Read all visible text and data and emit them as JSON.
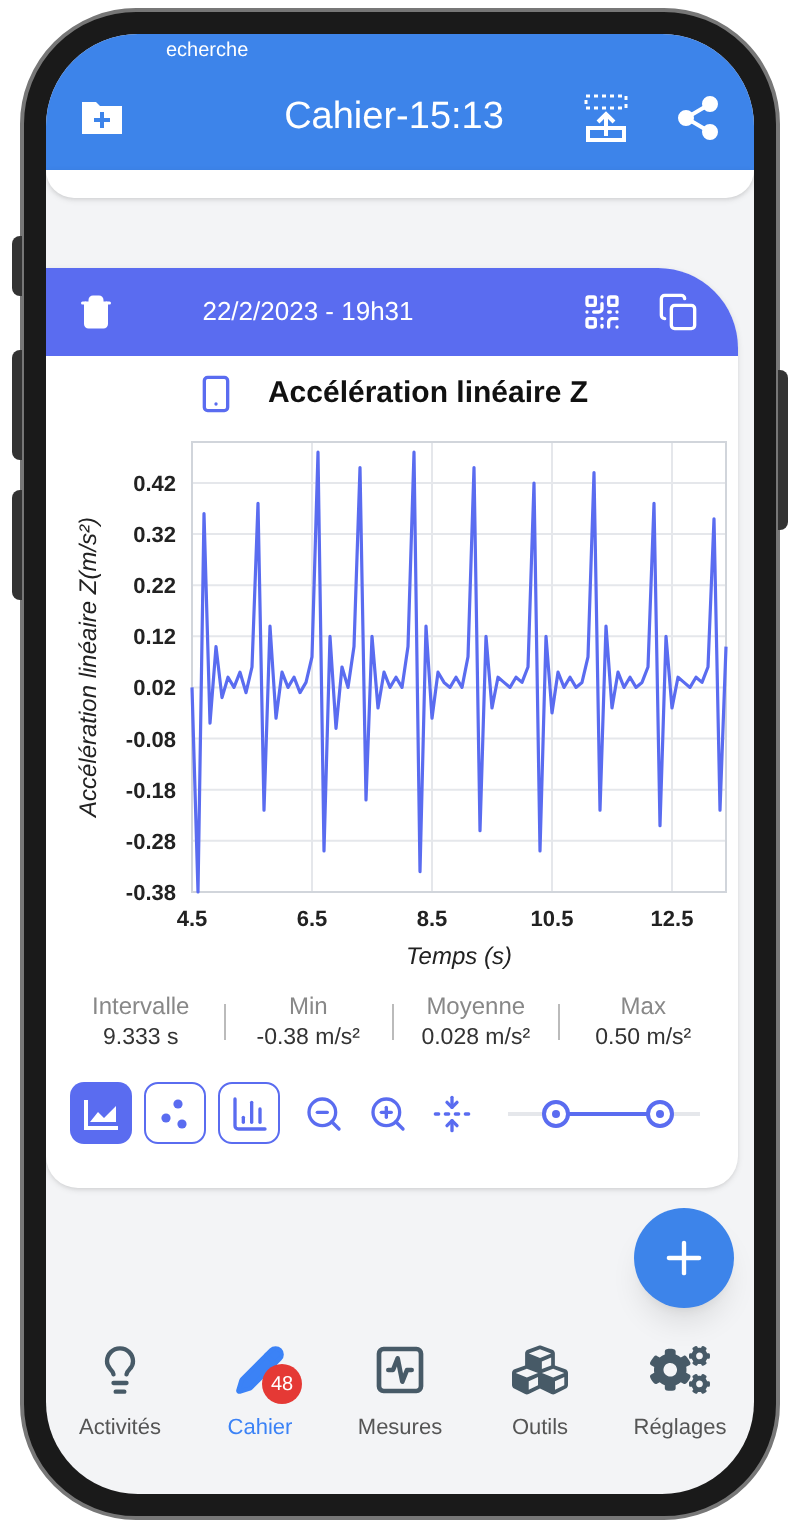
{
  "status_bar": {
    "text": "echerche"
  },
  "header": {
    "title": "Cahier-15:13"
  },
  "entry": {
    "date": "22/2/2023 - 19h31",
    "title": "Accélération linéaire Z",
    "chart_data": {
      "type": "line",
      "xlabel": "Temps (s)",
      "ylabel": "Accélération linéaire Z(m/s²)",
      "x": [
        4.5,
        4.6,
        4.7,
        4.8,
        4.9,
        5.0,
        5.1,
        5.2,
        5.3,
        5.4,
        5.5,
        5.6,
        5.7,
        5.8,
        5.9,
        6.0,
        6.1,
        6.2,
        6.3,
        6.4,
        6.5,
        6.6,
        6.7,
        6.8,
        6.9,
        7.0,
        7.1,
        7.2,
        7.3,
        7.4,
        7.5,
        7.6,
        7.7,
        7.8,
        7.9,
        8.0,
        8.1,
        8.2,
        8.3,
        8.4,
        8.5,
        8.6,
        8.7,
        8.8,
        8.9,
        9.0,
        9.1,
        9.2,
        9.3,
        9.4,
        9.5,
        9.6,
        9.7,
        9.8,
        9.9,
        10.0,
        10.1,
        10.2,
        10.3,
        10.4,
        10.5,
        10.6,
        10.7,
        10.8,
        10.9,
        11.0,
        11.1,
        11.2,
        11.3,
        11.4,
        11.5,
        11.6,
        11.7,
        11.8,
        11.9,
        12.0,
        12.1,
        12.2,
        12.3,
        12.4,
        12.5,
        12.6,
        12.7,
        12.8,
        12.9,
        13.0,
        13.1,
        13.2,
        13.3,
        13.4
      ],
      "grid": true,
      "series": [
        {
          "color": "#5a6cf0",
          "values": [
            0.02,
            -0.38,
            0.36,
            -0.05,
            0.1,
            0.0,
            0.04,
            0.02,
            0.05,
            0.01,
            0.06,
            0.38,
            -0.22,
            0.14,
            -0.04,
            0.05,
            0.02,
            0.04,
            0.01,
            0.03,
            0.08,
            0.48,
            -0.3,
            0.12,
            -0.06,
            0.06,
            0.02,
            0.1,
            0.45,
            -0.2,
            0.12,
            -0.02,
            0.05,
            0.02,
            0.04,
            0.02,
            0.1,
            0.48,
            -0.34,
            0.14,
            -0.04,
            0.05,
            0.03,
            0.02,
            0.04,
            0.02,
            0.08,
            0.45,
            -0.26,
            0.12,
            -0.02,
            0.04,
            0.03,
            0.02,
            0.04,
            0.03,
            0.06,
            0.42,
            -0.3,
            0.12,
            -0.03,
            0.05,
            0.02,
            0.04,
            0.02,
            0.03,
            0.08,
            0.44,
            -0.22,
            0.14,
            -0.02,
            0.05,
            0.02,
            0.04,
            0.02,
            0.03,
            0.06,
            0.38,
            -0.25,
            0.12,
            -0.02,
            0.04,
            0.03,
            0.02,
            0.04,
            0.03,
            0.06,
            0.35,
            -0.22,
            0.1
          ]
        }
      ],
      "xlim": [
        4.5,
        13.4
      ],
      "ylim": [
        -0.38,
        0.5
      ],
      "xticks": [
        4.5,
        6.5,
        8.5,
        10.5,
        12.5
      ],
      "yticks": [
        0.42,
        0.32,
        0.22,
        0.12,
        0.02,
        -0.08,
        -0.18,
        -0.28,
        -0.38
      ]
    },
    "stats": [
      {
        "label": "Intervalle",
        "value": "9.333 s"
      },
      {
        "label": "Min",
        "value": "-0.38 m/s²"
      },
      {
        "label": "Moyenne",
        "value": "0.028 m/s²"
      },
      {
        "label": "Max",
        "value": "0.50 m/s²"
      }
    ],
    "chart_types": [
      {
        "kind": "line",
        "selected": true
      },
      {
        "kind": "scatter",
        "selected": false
      },
      {
        "kind": "bar",
        "selected": false
      }
    ]
  },
  "nav": [
    {
      "kind": "bulb",
      "label": "Activités",
      "selected": false
    },
    {
      "kind": "pen",
      "label": "Cahier",
      "selected": true,
      "badge": "48"
    },
    {
      "kind": "monitor",
      "label": "Mesures",
      "selected": false
    },
    {
      "kind": "cubes",
      "label": "Outils",
      "selected": false
    },
    {
      "kind": "gears",
      "label": "Réglages",
      "selected": false
    }
  ]
}
